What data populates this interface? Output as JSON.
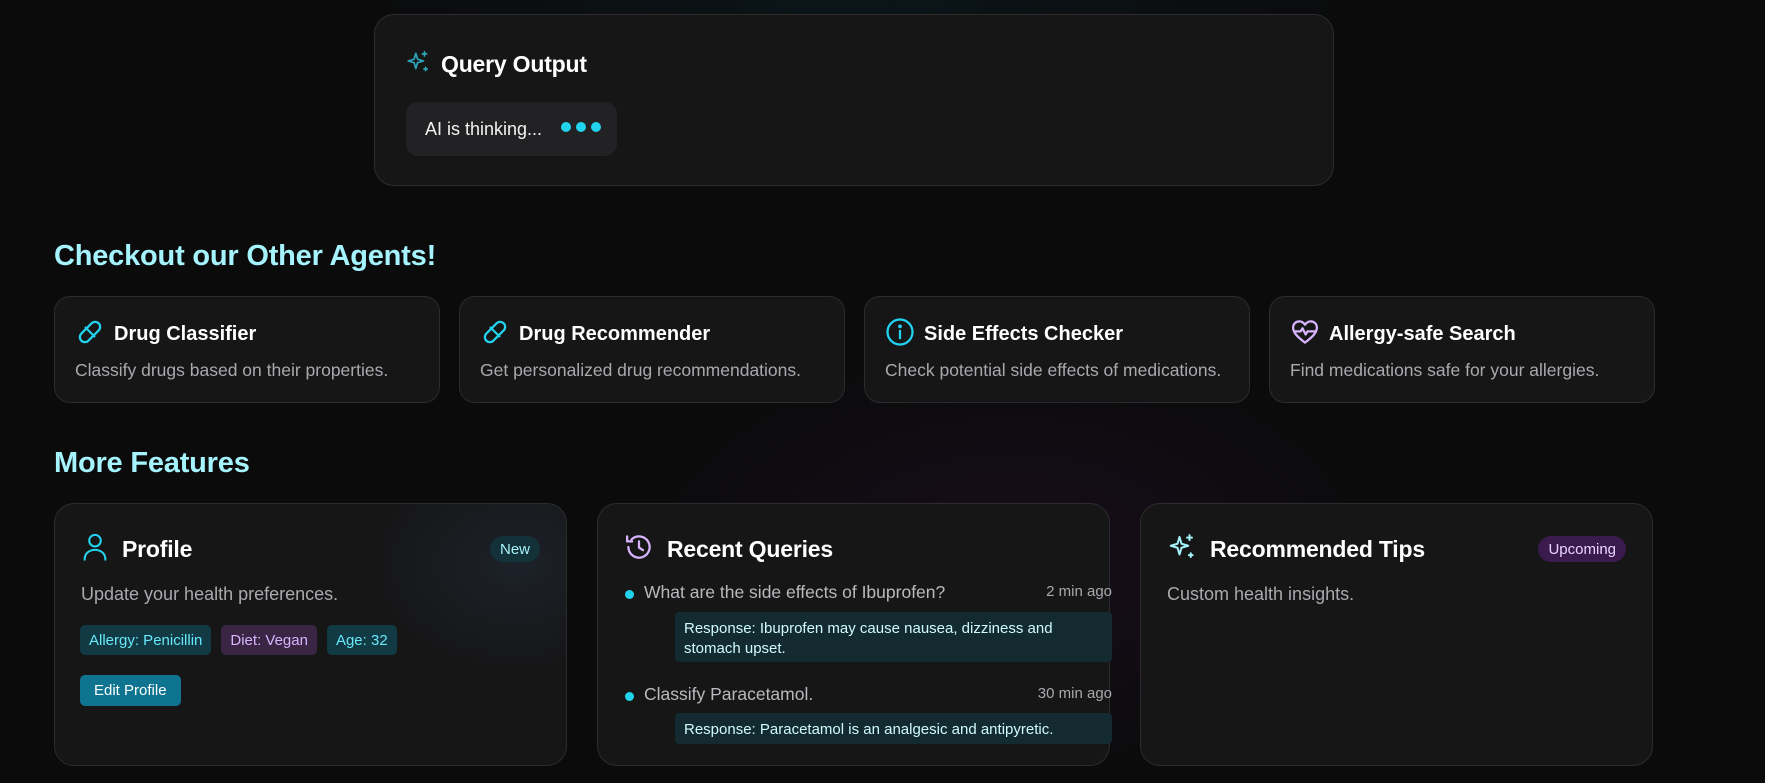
{
  "query_output": {
    "title": "Query Output",
    "thinking_text": "AI is thinking..."
  },
  "agents_section": {
    "title": "Checkout our Other Agents!",
    "items": [
      {
        "name": "Drug Classifier",
        "desc": "Classify drugs based on their properties.",
        "icon": "pill-icon"
      },
      {
        "name": "Drug Recommender",
        "desc": "Get personalized drug recommendations.",
        "icon": "pill-icon"
      },
      {
        "name": "Side Effects Checker",
        "desc": "Check potential side effects of medications.",
        "icon": "info-icon"
      },
      {
        "name": "Allergy-safe Search",
        "desc": "Find medications safe for your allergies.",
        "icon": "heart-pulse-icon"
      }
    ]
  },
  "features_section": {
    "title": "More Features",
    "profile": {
      "title": "Profile",
      "badge": "New",
      "desc": "Update your health preferences.",
      "tags": [
        "Allergy: Penicillin",
        "Diet: Vegan",
        "Age: 32"
      ],
      "edit_label": "Edit Profile"
    },
    "recent": {
      "title": "Recent Queries",
      "items": [
        {
          "question": "What are the side effects of Ibuprofen?",
          "time": "2 min ago",
          "response": "Response: Ibuprofen may cause nausea, dizziness and stomach upset."
        },
        {
          "question": "Classify Paracetamol.",
          "time": "30 min ago",
          "response": "Response: Paracetamol is an analgesic and antipyretic."
        }
      ]
    },
    "tips": {
      "title": "Recommended Tips",
      "badge": "Upcoming",
      "desc": "Custom health insights."
    }
  },
  "colors": {
    "accent_cyan": "#22d3ee",
    "heading_cyan": "#a5f3fc",
    "accent_purple": "#d8b4fe",
    "button": "#0e7490"
  }
}
